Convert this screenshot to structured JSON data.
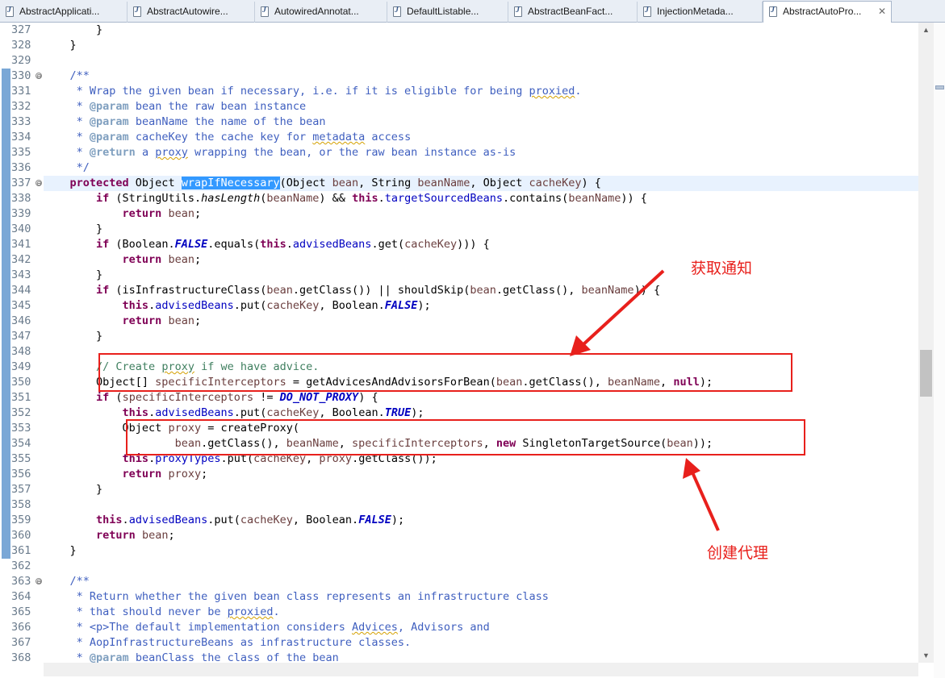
{
  "tabs": [
    {
      "label": "AbstractApplicati...",
      "active": false
    },
    {
      "label": "AbstractAutowire...",
      "active": false
    },
    {
      "label": "AutowiredAnnotat...",
      "active": false
    },
    {
      "label": "DefaultListable...",
      "active": false
    },
    {
      "label": "AbstractBeanFact...",
      "active": false
    },
    {
      "label": "InjectionMetada...",
      "active": false
    },
    {
      "label": "AbstractAutoPro...",
      "active": true
    }
  ],
  "close_glyph": "✕",
  "folded_marker": "⊖",
  "line_numbers": [
    "327",
    "328",
    "329",
    "330",
    "331",
    "332",
    "333",
    "334",
    "335",
    "336",
    "337",
    "338",
    "339",
    "340",
    "341",
    "342",
    "343",
    "344",
    "345",
    "346",
    "347",
    "348",
    "349",
    "350",
    "351",
    "352",
    "353",
    "354",
    "355",
    "356",
    "357",
    "358",
    "359",
    "360",
    "361",
    "362",
    "363",
    "364",
    "365",
    "366",
    "367",
    "368"
  ],
  "code_lines": [
    [
      [
        "p",
        "        }"
      ]
    ],
    [
      [
        "p",
        "    }"
      ]
    ],
    [
      [
        "p",
        ""
      ]
    ],
    [
      [
        "jd",
        "    /**"
      ]
    ],
    [
      [
        "jd",
        "     * Wrap the given bean if necessary, i.e. if it is eligible for being "
      ],
      [
        "jdsq",
        "proxied"
      ],
      [
        "jd",
        "."
      ]
    ],
    [
      [
        "jd",
        "     * "
      ],
      [
        "jdt",
        "@param"
      ],
      [
        "jd",
        " bean the raw bean instance"
      ]
    ],
    [
      [
        "jd",
        "     * "
      ],
      [
        "jdt",
        "@param"
      ],
      [
        "jd",
        " beanName the name of the bean"
      ]
    ],
    [
      [
        "jd",
        "     * "
      ],
      [
        "jdt",
        "@param"
      ],
      [
        "jd",
        " cacheKey the cache key for "
      ],
      [
        "jdsq",
        "metadata"
      ],
      [
        "jd",
        " access"
      ]
    ],
    [
      [
        "jd",
        "     * "
      ],
      [
        "jdt",
        "@return"
      ],
      [
        "jd",
        " a "
      ],
      [
        "jdsq",
        "proxy"
      ],
      [
        "jd",
        " wrapping the bean, or the raw bean instance as-is"
      ]
    ],
    [
      [
        "jd",
        "     */"
      ]
    ],
    [
      [
        "p",
        "    "
      ],
      [
        "kw",
        "protected"
      ],
      [
        "p",
        " Object "
      ],
      [
        "sel",
        "wrapIfNecessary"
      ],
      [
        "p",
        "(Object "
      ],
      [
        "par",
        "bean"
      ],
      [
        "p",
        ", String "
      ],
      [
        "par",
        "beanName"
      ],
      [
        "p",
        ", Object "
      ],
      [
        "par",
        "cacheKey"
      ],
      [
        "p",
        ") {"
      ]
    ],
    [
      [
        "p",
        "        "
      ],
      [
        "kw",
        "if"
      ],
      [
        "p",
        " (StringUtils."
      ],
      [
        "smeth",
        "hasLength"
      ],
      [
        "p",
        "("
      ],
      [
        "par",
        "beanName"
      ],
      [
        "p",
        ") && "
      ],
      [
        "kw",
        "this"
      ],
      [
        "p",
        "."
      ],
      [
        "fld",
        "targetSourcedBeans"
      ],
      [
        "p",
        ".contains("
      ],
      [
        "par",
        "beanName"
      ],
      [
        "p",
        ")) {"
      ]
    ],
    [
      [
        "p",
        "            "
      ],
      [
        "kw",
        "return"
      ],
      [
        "p",
        " "
      ],
      [
        "par",
        "bean"
      ],
      [
        "p",
        ";"
      ]
    ],
    [
      [
        "p",
        "        }"
      ]
    ],
    [
      [
        "p",
        "        "
      ],
      [
        "kw",
        "if"
      ],
      [
        "p",
        " (Boolean."
      ],
      [
        "sfld",
        "FALSE"
      ],
      [
        "p",
        ".equals("
      ],
      [
        "kw",
        "this"
      ],
      [
        "p",
        "."
      ],
      [
        "fld",
        "advisedBeans"
      ],
      [
        "p",
        ".get("
      ],
      [
        "par",
        "cacheKey"
      ],
      [
        "p",
        ")))"
      ],
      [
        "p",
        " {"
      ]
    ],
    [
      [
        "p",
        "            "
      ],
      [
        "kw",
        "return"
      ],
      [
        "p",
        " "
      ],
      [
        "par",
        "bean"
      ],
      [
        "p",
        ";"
      ]
    ],
    [
      [
        "p",
        "        }"
      ]
    ],
    [
      [
        "p",
        "        "
      ],
      [
        "kw",
        "if"
      ],
      [
        "p",
        " (isInfrastructureClass("
      ],
      [
        "par",
        "bean"
      ],
      [
        "p",
        ".getClass()) || shouldSkip("
      ],
      [
        "par",
        "bean"
      ],
      [
        "p",
        ".getClass(), "
      ],
      [
        "par",
        "beanName"
      ],
      [
        "p",
        ")) {"
      ]
    ],
    [
      [
        "p",
        "            "
      ],
      [
        "kw",
        "this"
      ],
      [
        "p",
        "."
      ],
      [
        "fld",
        "advisedBeans"
      ],
      [
        "p",
        ".put("
      ],
      [
        "par",
        "cacheKey"
      ],
      [
        "p",
        ", Boolean."
      ],
      [
        "sfld",
        "FALSE"
      ],
      [
        "p",
        ");"
      ]
    ],
    [
      [
        "p",
        "            "
      ],
      [
        "kw",
        "return"
      ],
      [
        "p",
        " "
      ],
      [
        "par",
        "bean"
      ],
      [
        "p",
        ";"
      ]
    ],
    [
      [
        "p",
        "        }"
      ]
    ],
    [
      [
        "p",
        ""
      ]
    ],
    [
      [
        "cm",
        "        // Create "
      ],
      [
        "cmsq",
        "proxy"
      ],
      [
        "cm",
        " if we have advice."
      ]
    ],
    [
      [
        "p",
        "        Object[] "
      ],
      [
        "par",
        "specificInterceptors"
      ],
      [
        "p",
        " = getAdvicesAndAdvisorsForBean("
      ],
      [
        "par",
        "bean"
      ],
      [
        "p",
        ".getClass(), "
      ],
      [
        "par",
        "beanName"
      ],
      [
        "p",
        ", "
      ],
      [
        "kw",
        "null"
      ],
      [
        "p",
        ");"
      ]
    ],
    [
      [
        "p",
        "        "
      ],
      [
        "kw",
        "if"
      ],
      [
        "p",
        " ("
      ],
      [
        "par",
        "specificInterceptors"
      ],
      [
        "p",
        " != "
      ],
      [
        "sfld",
        "DO_NOT_PROXY"
      ],
      [
        "p",
        ") {"
      ]
    ],
    [
      [
        "p",
        "            "
      ],
      [
        "kw",
        "this"
      ],
      [
        "p",
        "."
      ],
      [
        "fld",
        "advisedBeans"
      ],
      [
        "p",
        ".put("
      ],
      [
        "par",
        "cacheKey"
      ],
      [
        "p",
        ", Boolean."
      ],
      [
        "sfld",
        "TRUE"
      ],
      [
        "p",
        ");"
      ]
    ],
    [
      [
        "p",
        "            Object "
      ],
      [
        "par",
        "proxy"
      ],
      [
        "p",
        " = createProxy("
      ]
    ],
    [
      [
        "p",
        "                    "
      ],
      [
        "par",
        "bean"
      ],
      [
        "p",
        ".getClass(), "
      ],
      [
        "par",
        "beanName"
      ],
      [
        "p",
        ", "
      ],
      [
        "par",
        "specificInterceptors"
      ],
      [
        "p",
        ", "
      ],
      [
        "kw",
        "new"
      ],
      [
        "p",
        " SingletonTargetSource("
      ],
      [
        "par",
        "bean"
      ],
      [
        "p",
        "));"
      ]
    ],
    [
      [
        "p",
        "            "
      ],
      [
        "kw",
        "this"
      ],
      [
        "p",
        "."
      ],
      [
        "fld",
        "proxyTypes"
      ],
      [
        "p",
        ".put("
      ],
      [
        "par",
        "cacheKey"
      ],
      [
        "p",
        ", "
      ],
      [
        "par",
        "proxy"
      ],
      [
        "p",
        ".getClass());"
      ]
    ],
    [
      [
        "p",
        "            "
      ],
      [
        "kw",
        "return"
      ],
      [
        "p",
        " "
      ],
      [
        "par",
        "proxy"
      ],
      [
        "p",
        ";"
      ]
    ],
    [
      [
        "p",
        "        }"
      ]
    ],
    [
      [
        "p",
        ""
      ]
    ],
    [
      [
        "p",
        "        "
      ],
      [
        "kw",
        "this"
      ],
      [
        "p",
        "."
      ],
      [
        "fld",
        "advisedBeans"
      ],
      [
        "p",
        ".put("
      ],
      [
        "par",
        "cacheKey"
      ],
      [
        "p",
        ", Boolean."
      ],
      [
        "sfld",
        "FALSE"
      ],
      [
        "p",
        ");"
      ]
    ],
    [
      [
        "p",
        "        "
      ],
      [
        "kw",
        "return"
      ],
      [
        "p",
        " "
      ],
      [
        "par",
        "bean"
      ],
      [
        "p",
        ";"
      ]
    ],
    [
      [
        "p",
        "    }"
      ]
    ],
    [
      [
        "p",
        ""
      ]
    ],
    [
      [
        "jd",
        "    /**"
      ]
    ],
    [
      [
        "jd",
        "     * Return whether the given bean class represents an infrastructure class"
      ]
    ],
    [
      [
        "jd",
        "     * that should never be "
      ],
      [
        "jdsq",
        "proxied"
      ],
      [
        "jd",
        "."
      ]
    ],
    [
      [
        "jd",
        "     * <p>The default implementation considers "
      ],
      [
        "jdsq",
        "Advices"
      ],
      [
        "jd",
        ", Advisors and"
      ]
    ],
    [
      [
        "jd",
        "     * AopInfrastructureBeans as infrastructure classes."
      ]
    ],
    [
      [
        "jd",
        "     * "
      ],
      [
        "jdt",
        "@param"
      ],
      [
        "jd",
        " beanClass the class of the bean"
      ]
    ]
  ],
  "annotations": {
    "get_advice": "获取通知",
    "create_proxy": "创建代理"
  },
  "colors": {
    "annotation": "#e8201c",
    "keyword": "#7f0055",
    "javadoc": "#3f5fbf",
    "comment": "#3f7f5f",
    "field": "#0000c0",
    "selection": "#3399ff"
  },
  "scroll_arrows": {
    "up": "▲",
    "down": "▼"
  }
}
